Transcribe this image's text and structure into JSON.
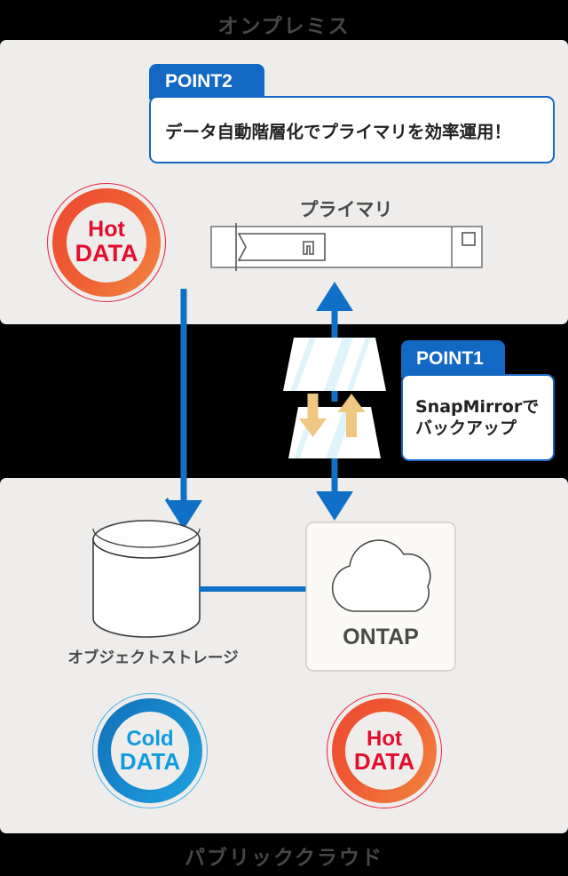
{
  "bands": {
    "top_label": "オンプレミス",
    "bottom_label": "パブリッククラウド"
  },
  "colors": {
    "panel_bg": "#EEEDEB",
    "outer_bg": "#000000",
    "accent_blue": "#1268C3",
    "arrow_blue": "#1070C8",
    "hot_red": "#E30D2E",
    "hot_ring_start": "#EE4A32",
    "hot_ring_end": "#F1873F",
    "cold_blue": "#0E9BE0",
    "cold_ring_start": "#1170B8",
    "cold_ring_end": "#1FA2E0",
    "label_gray": "#4A4A4A",
    "tier_arrow_tan": "#EFC782",
    "stack_tint": "#DFF4FA"
  },
  "callouts": [
    {
      "tab": "POINT2",
      "body_lines": [
        "データ自動階層化でプライマリを効率運用！"
      ]
    },
    {
      "tab": "POINT1",
      "body_lines": [
        "SnapMirrorで",
        "バックアップ"
      ]
    }
  ],
  "point2": {
    "tab": "POINT2",
    "body": "データ自動階層化でプライマリを効率運用！"
  },
  "point1": {
    "tab": "POINT1",
    "line1": "SnapMirrorで",
    "line2": "バックアップ"
  },
  "badges": {
    "hot_top": {
      "line1": "Hot",
      "line2": "DATA"
    },
    "cold_bottom": {
      "line1": "Cold",
      "line2": "DATA"
    },
    "hot_bottom": {
      "line1": "Hot",
      "line2": "DATA"
    }
  },
  "nodes": {
    "primary_label": "プライマリ",
    "object_storage_label": "オブジェクトストレージ",
    "ontap_label": "ONTAP"
  },
  "icons": {
    "server": "server-appliance-icon",
    "tiering": "data-tiering-icon",
    "cylinder": "database-cylinder-icon",
    "cloud": "cloud-icon"
  }
}
